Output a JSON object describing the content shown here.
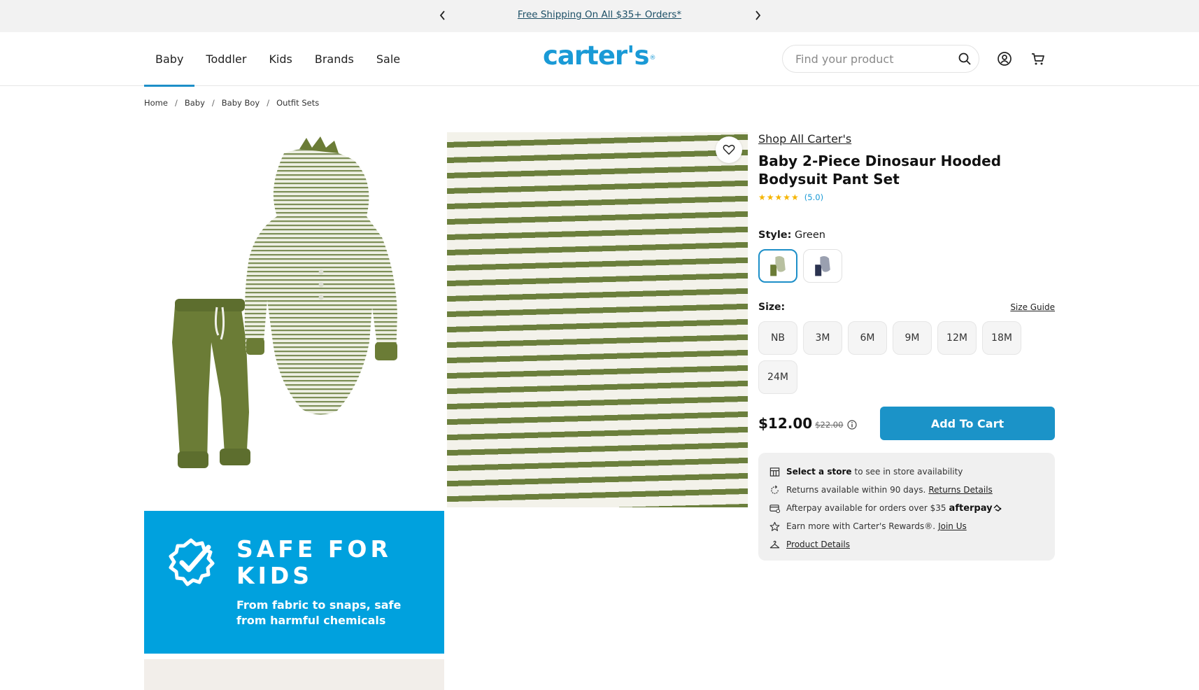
{
  "promo": {
    "text": "Free Shipping On All $35+ Orders*"
  },
  "header": {
    "nav": [
      {
        "label": "Baby",
        "active": true
      },
      {
        "label": "Toddler"
      },
      {
        "label": "Kids"
      },
      {
        "label": "Brands"
      },
      {
        "label": "Sale"
      }
    ],
    "logo": "carter's",
    "search_placeholder": "Find your product"
  },
  "breadcrumb": [
    "Home",
    "Baby",
    "Baby Boy",
    "Outfit Sets"
  ],
  "banner": {
    "title": "SAFE FOR KIDS",
    "subtitle": "From fabric to snaps, safe from harmful chemicals"
  },
  "product": {
    "shop_all": "Shop All Carter's",
    "title": "Baby 2-Piece Dinosaur Hooded Bodysuit Pant Set",
    "rating": 5.0,
    "rating_text": "(5.0)",
    "style_label": "Style:",
    "style_value": "Green",
    "swatches": [
      {
        "name": "Green",
        "selected": true,
        "color": "#6b7f3c"
      },
      {
        "name": "Navy",
        "selected": false,
        "color": "#2b3350"
      }
    ],
    "size_label": "Size:",
    "size_guide": "Size Guide",
    "sizes": [
      "NB",
      "3M",
      "6M",
      "9M",
      "12M",
      "18M",
      "24M"
    ],
    "price": "$12.00",
    "price_old": "$22.00",
    "add_to_cart": "Add To Cart",
    "info": {
      "store_bold": "Select a store",
      "store_rest": "to see in store availability",
      "returns_text": "Returns available within 90 days.",
      "returns_link": "Returns Details",
      "afterpay_text": "Afterpay available for orders over $35",
      "afterpay_brand": "afterpay",
      "rewards_text": "Earn more with Carter's Rewards®.",
      "rewards_link": "Join Us",
      "details_link": "Product Details"
    }
  },
  "colors": {
    "brand_blue": "#1a9ad6",
    "button_blue": "#1b93c8",
    "banner_blue": "#00a1de",
    "olive_green": "#6b7f3c",
    "star_gold": "#f5b400"
  }
}
